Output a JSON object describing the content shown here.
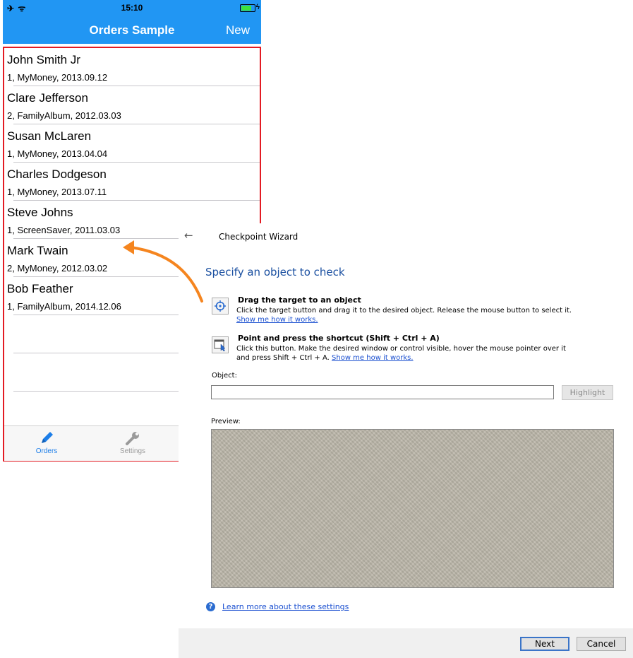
{
  "phone": {
    "status": {
      "icons": "✈ ᯤ",
      "time": "15:10"
    },
    "navbar": {
      "title": "Orders Sample",
      "new_label": "New"
    },
    "orders": [
      {
        "name": "John Smith Jr",
        "detail": "1, MyMoney, 2013.09.12"
      },
      {
        "name": "Clare Jefferson",
        "detail": "2, FamilyAlbum, 2012.03.03"
      },
      {
        "name": "Susan McLaren",
        "detail": "1, MyMoney, 2013.04.04"
      },
      {
        "name": "Charles Dodgeson",
        "detail": "1, MyMoney, 2013.07.11"
      },
      {
        "name": "Steve Johns",
        "detail": "1, ScreenSaver, 2011.03.03"
      },
      {
        "name": "Mark Twain",
        "detail": "2, MyMoney, 2012.03.02"
      },
      {
        "name": "Bob Feather",
        "detail": "1, FamilyAlbum, 2014.12.06"
      }
    ],
    "tabs": {
      "orders": "Orders",
      "settings": "Settings"
    }
  },
  "wizard": {
    "title": "Checkpoint Wizard",
    "heading": "Specify an object to check",
    "option1": {
      "title": "Drag the target to an object",
      "desc": "Click the target button and drag it to the desired object. Release the mouse button to select it.",
      "link": "Show me how it works."
    },
    "option2": {
      "title": "Point and press the shortcut (Shift + Ctrl + A)",
      "desc1": "Click this button. Make the desired window or control visible, hover the mouse pointer over it",
      "desc2": "and press Shift + Ctrl + A.",
      "link": "Show me how it works."
    },
    "object_label": "Object:",
    "object_value": "",
    "highlight_label": "Highlight",
    "preview_label": "Preview:",
    "help_link": "Learn more about these settings",
    "next_label": "Next",
    "cancel_label": "Cancel"
  },
  "colors": {
    "ios_blue": "#2196f3",
    "frame_red": "#e31b23",
    "arrow_orange": "#f5851f",
    "link_blue": "#1a4fd0"
  }
}
